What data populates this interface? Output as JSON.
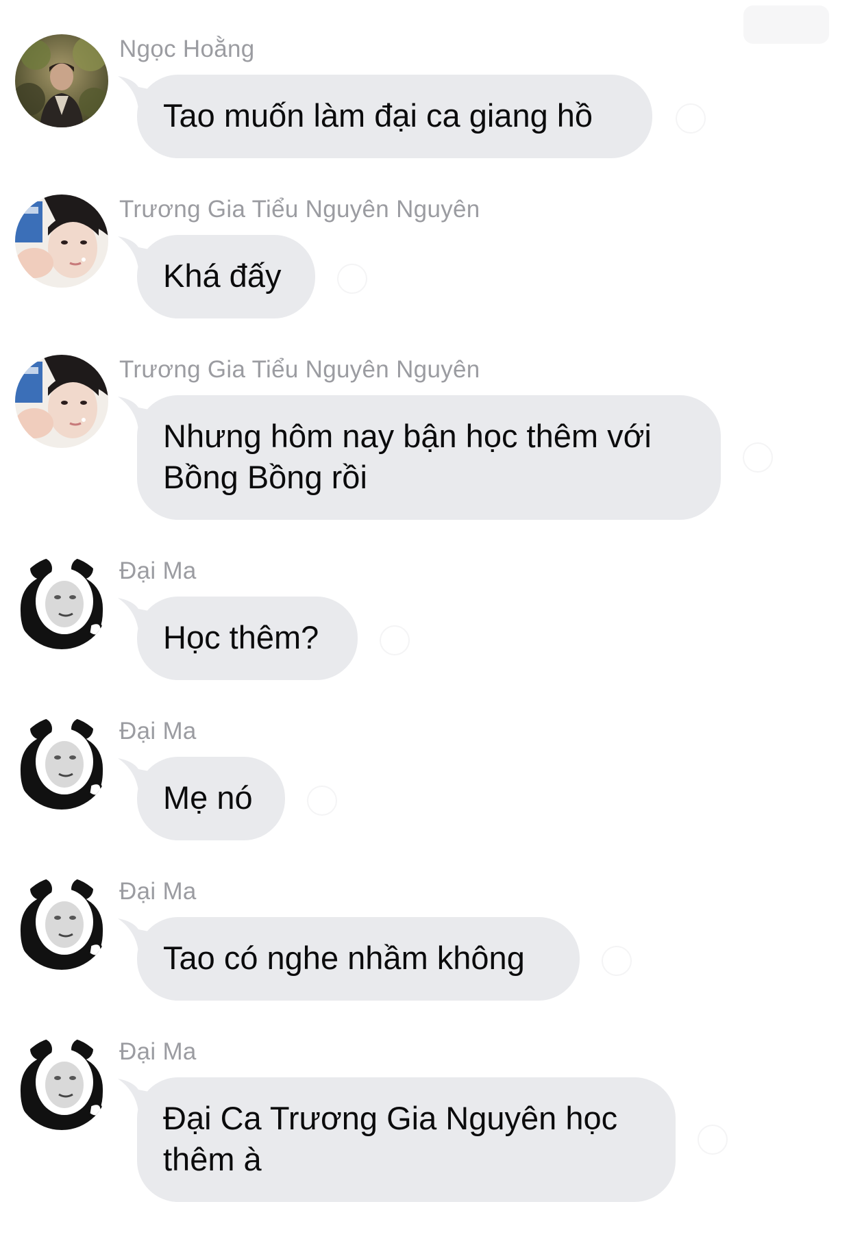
{
  "top_button": {
    "label": ""
  },
  "messages": [
    {
      "sender": "Ngọc Hoằng",
      "text": "Tao muốn làm đại ca giang hồ",
      "avatar": "person-photo-avatar"
    },
    {
      "sender": "Trương Gia Tiểu Nguyên Nguyên",
      "text": "Khá đấy",
      "avatar": "selfie-avatar"
    },
    {
      "sender": "Trương Gia Tiểu Nguyên Nguyên",
      "text": "Nhưng hôm nay bận học thêm với Bồng Bồng rồi",
      "avatar": "selfie-avatar"
    },
    {
      "sender": "Đại Ma",
      "text": "Học thêm?",
      "avatar": "panda-meme-avatar"
    },
    {
      "sender": "Đại Ma",
      "text": "Mẹ nó",
      "avatar": "panda-meme-avatar"
    },
    {
      "sender": "Đại Ma",
      "text": "Tao có nghe nhầm không",
      "avatar": "panda-meme-avatar"
    },
    {
      "sender": "Đại Ma",
      "text": "Đại Ca Trương Gia Nguyên học thêm à",
      "avatar": "panda-meme-avatar"
    }
  ]
}
